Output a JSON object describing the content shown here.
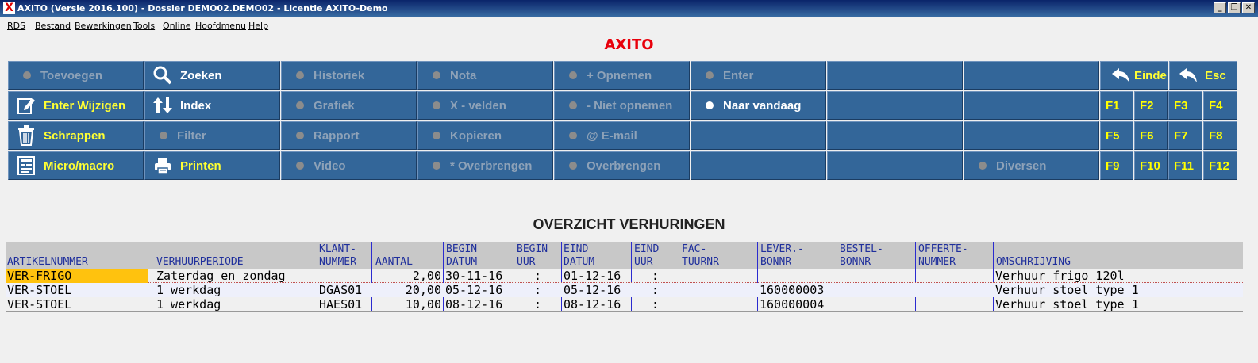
{
  "window": {
    "title": "AXITO (Versie 2016.100) - Dossier DEMO02.DEMO02 - Licentie AXITO-Demo",
    "app_icon": "X"
  },
  "menubar": [
    "RDS",
    "Bestand",
    "Bewerkingen",
    "Tools",
    "Online",
    "Hoofdmenu",
    "Help"
  ],
  "app_title": "AXITO",
  "toolbar": {
    "row1": {
      "c1": "Toevoegen",
      "c2": "Zoeken",
      "c3": "Historiek",
      "c4": "Nota",
      "c5": "+ Opnemen",
      "c6": "Enter",
      "einde": "Einde",
      "esc": "Esc"
    },
    "row2": {
      "c1": "Enter Wijzigen",
      "c2": "Index",
      "c3": "Grafiek",
      "c4": "X - velden",
      "c5": "- Niet opnemen",
      "c6": "Naar vandaag",
      "f1": "F1",
      "f2": "F2",
      "f3": "F3",
      "f4": "F4"
    },
    "row3": {
      "c1": "Schrappen",
      "c2": "Filter",
      "c3": "Rapport",
      "c4": "Kopieren",
      "c5": "@ E-mail",
      "f5": "F5",
      "f6": "F6",
      "f7": "F7",
      "f8": "F8"
    },
    "row4": {
      "c1": "Micro/macro",
      "c2": "Printen",
      "c3": "Video",
      "c4": "* Overbrengen",
      "c5": "Overbrengen",
      "c8": "Diversen",
      "f9": "F9",
      "f10": "F10",
      "f11": "F11",
      "f12": "F12"
    }
  },
  "section_title": "OVERZICHT VERHURINGEN",
  "table": {
    "headers": {
      "artikelnummer": "ARTIKELNUMMER",
      "verhuurperiode": "VERHUURPERIODE",
      "klantnummer": "KLANT-\nNUMMER",
      "aantal": "AANTAL",
      "begin_datum": "BEGIN\nDATUM",
      "begin_uur": "BEGIN\nUUR",
      "eind_datum": "EIND\nDATUM",
      "eind_uur": "EIND\nUUR",
      "factuurnr": "FAC-\nTUURNR",
      "leverbonnr": "LEVER.-\nBONNR",
      "bestelbonnr": "BESTEL-\nBONNR",
      "offertenummer": "OFFERTE-\nNUMMER",
      "omschrijving": "OMSCHRIJVING"
    },
    "rows": [
      {
        "artikelnummer": "VER-FRIGO",
        "verhuurperiode": "Zaterdag en zondag",
        "klantnummer": "",
        "aantal": "2,00",
        "begin_datum": "30-11-16",
        "begin_uur": ":",
        "eind_datum": "01-12-16",
        "eind_uur": ":",
        "factuurnr": "",
        "leverbonnr": "",
        "bestelbonnr": "",
        "offertenummer": "",
        "omschrijving": "Verhuur frigo 120l"
      },
      {
        "artikelnummer": "VER-STOEL",
        "verhuurperiode": "1 werkdag",
        "klantnummer": "DGAS01",
        "aantal": "20,00",
        "begin_datum": "05-12-16",
        "begin_uur": ":",
        "eind_datum": "05-12-16",
        "eind_uur": ":",
        "factuurnr": "",
        "leverbonnr": "160000003",
        "bestelbonnr": "",
        "offertenummer": "",
        "omschrijving": "Verhuur stoel type 1"
      },
      {
        "artikelnummer": "VER-STOEL",
        "verhuurperiode": "1 werkdag",
        "klantnummer": "HAES01",
        "aantal": "10,00",
        "begin_datum": "08-12-16",
        "begin_uur": ":",
        "eind_datum": "08-12-16",
        "eind_uur": ":",
        "factuurnr": "",
        "leverbonnr": "160000004",
        "bestelbonnr": "",
        "offertenummer": "",
        "omschrijving": "Verhuur stoel type 1"
      }
    ]
  },
  "colors": {
    "button_bg": "#336699",
    "accent_yellow": "#ffff00",
    "title_red": "#e8000b",
    "header_text": "#1f2f9c",
    "selection": "#ffc20e"
  }
}
